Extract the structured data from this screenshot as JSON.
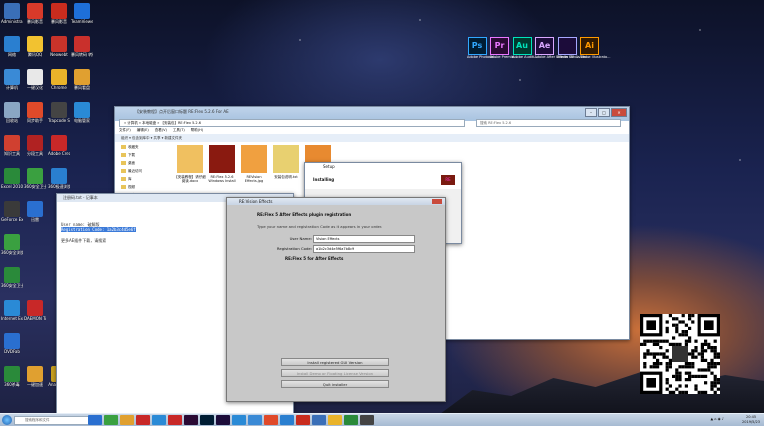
{
  "desktop": {
    "left_icons": [
      {
        "label": "Administra...",
        "color": "#3a6fb8"
      },
      {
        "label": "暴风影音",
        "color": "#d83a2a"
      },
      {
        "label": "暴风影音",
        "color": "#c92c1e"
      },
      {
        "label": "TeamViewer 14",
        "color": "#1e6fd9"
      },
      {
        "label": "网络",
        "color": "#2a7fd0"
      },
      {
        "label": "腾讯QQ",
        "color": "#f2c230"
      },
      {
        "label": "Neowebt",
        "color": "#c8332a"
      },
      {
        "label": "暴风转码 转码",
        "color": "#c9302c"
      },
      {
        "label": "计算机",
        "color": "#3a8ad6"
      },
      {
        "label": "一键汉化",
        "color": "#e8e8e8"
      },
      {
        "label": "Chrome",
        "color": "#e9b32a"
      },
      {
        "label": "暴风看盘",
        "color": "#e0a030"
      },
      {
        "label": "回收站",
        "color": "#8aa6c4"
      },
      {
        "label": "同步助手",
        "color": "#e04a2a"
      },
      {
        "label": "Trapcode Suite 13.1...",
        "color": "#444"
      },
      {
        "label": "电脑管家",
        "color": "#2a8ad6"
      },
      {
        "label": "知识工具",
        "color": "#d04030"
      },
      {
        "label": "分段工具",
        "color": "#b02222"
      },
      {
        "label": "Adobe Creati...",
        "color": "#c82828"
      },
      {
        "label": "",
        "color": "#000"
      },
      {
        "label": "Excel 2010 新建工具",
        "color": "#2a8a3a"
      },
      {
        "label": "360安全卫士",
        "color": "#3aa040"
      },
      {
        "label": "360极速浏览器",
        "color": "#2a7fd0"
      },
      {
        "label": "",
        "color": "#000"
      },
      {
        "label": "GeForce Experience",
        "color": "#3a3a3a"
      },
      {
        "label": "迅雷",
        "color": "#2a6fd0"
      },
      {
        "label": "",
        "color": "#000"
      },
      {
        "label": "",
        "color": "#000"
      },
      {
        "label": "360安全浏览",
        "color": "#3aa040"
      },
      {
        "label": "",
        "color": "#000"
      },
      {
        "label": "",
        "color": "#000"
      },
      {
        "label": "",
        "color": "#000"
      },
      {
        "label": "360安全卫士",
        "color": "#2a8a3a"
      },
      {
        "label": "",
        "color": "#000"
      },
      {
        "label": "",
        "color": "#000"
      },
      {
        "label": "",
        "color": "#000"
      },
      {
        "label": "Internet Explorer",
        "color": "#2a8ad6"
      },
      {
        "label": "DAEMON Tools Lite",
        "color": "#c82828"
      },
      {
        "label": "",
        "color": "#000"
      },
      {
        "label": "",
        "color": "#000"
      },
      {
        "label": "DVDFab",
        "color": "#2a6fd0"
      },
      {
        "label": "",
        "color": "#000"
      },
      {
        "label": "",
        "color": "#000"
      },
      {
        "label": "",
        "color": "#000"
      },
      {
        "label": "360杀毒",
        "color": "#2a8a3a"
      },
      {
        "label": "一键加速",
        "color": "#e0a030"
      },
      {
        "label": "Analog Pro",
        "color": "#c8a020"
      },
      {
        "label": "",
        "color": "#000"
      }
    ],
    "adobe_icons": [
      {
        "abbr": "Ps",
        "label": "Adobe Photosh...",
        "bg": "#001d34",
        "fg": "#31a8ff"
      },
      {
        "abbr": "Pr",
        "label": "Adobe Premie...",
        "bg": "#2a0a34",
        "fg": "#ea77ff"
      },
      {
        "abbr": "Au",
        "label": "Adobe Auditi...",
        "bg": "#003a2e",
        "fg": "#00e4bb"
      },
      {
        "abbr": "Ae",
        "label": "Adobe After Effects CC ...",
        "bg": "#1c0c3a",
        "fg": "#d9a7ff"
      },
      {
        "abbr": "",
        "label": "Adobe Media Enc...",
        "bg": "#1c0c3a",
        "fg": "#a7a7ff"
      },
      {
        "abbr": "Ai",
        "label": "Adobe Illustrato...",
        "bg": "#321a00",
        "fg": "#ff9a00"
      }
    ]
  },
  "explorer": {
    "title": "【安装教程】点开后窗口标题 RE:Flex 5.2.6 For AE",
    "address": "« 计算机 » 本地磁盘 » 【安装包】RE:Flex 5.2.6",
    "search": "搜索 RE:Flex 5.2.6",
    "menu": [
      "文件(F)",
      "编辑(E)",
      "查看(V)",
      "工具(T)",
      "帮助(H)"
    ],
    "toolbar": "组织 ▾    包含到库中 ▾    共享 ▾    新建文件夹",
    "nav": [
      "收藏夹",
      "下载",
      "桌面",
      "最近访问",
      "库",
      "视频",
      "图片",
      "文档",
      "音乐",
      "计算机",
      "网络"
    ],
    "files": [
      {
        "label": "【安装教程】请仔细阅读.docx",
        "color": "#f0c060"
      },
      {
        "label": "RE:Flex 5.2.6 Windows Install",
        "color": "#8a1a10"
      },
      {
        "label": "REVision Effects.jpg",
        "color": "#f0a040"
      },
      {
        "label": "安装包说明.txt",
        "color": "#e8d070"
      },
      {
        "label": "",
        "color": "#e88a30"
      }
    ]
  },
  "setup": {
    "title": "Setup",
    "status": "Installing"
  },
  "editor": {
    "title": "注册码.txt - 记事本",
    "lines": [
      "User name: 破解版",
      "Registration Code: 1a2b3c4d5e6f"
    ],
    "note": "更多AE插件下载，请搜索"
  },
  "dialog": {
    "title": "RE:Vision Effects",
    "heading": "RE:Flex 5 After Effects plugin registration",
    "sub": "Type your name and registration Code as it appears in your order.",
    "user_label": "User Name:",
    "user_value": "Vision Effects",
    "code_label": "Registration Code:",
    "code_value": "a1b2c3d4e5f6a7b8c9",
    "product": "RE:Flex 5 for After Effects",
    "buttons": [
      "Install registered GUI Version",
      "Install Demo or Floating License Version",
      "Quit installer"
    ]
  },
  "taskbar": {
    "search_placeholder": "搜索程序和文件",
    "pinned": [
      "#2a6fd0",
      "#3aa040",
      "#e0a030",
      "#c82828",
      "#2a8ad6",
      "#c82828",
      "#2a0a34",
      "#001d34",
      "#1c0c3a",
      "#2a8ad6",
      "#3a8ad6",
      "#e04a2a",
      "#2a7fd0",
      "#c92c1e",
      "#3a6fb8",
      "#e9b32a",
      "#2a8a3a",
      "#444"
    ],
    "time": "20:45",
    "date": "2019/5/23"
  }
}
